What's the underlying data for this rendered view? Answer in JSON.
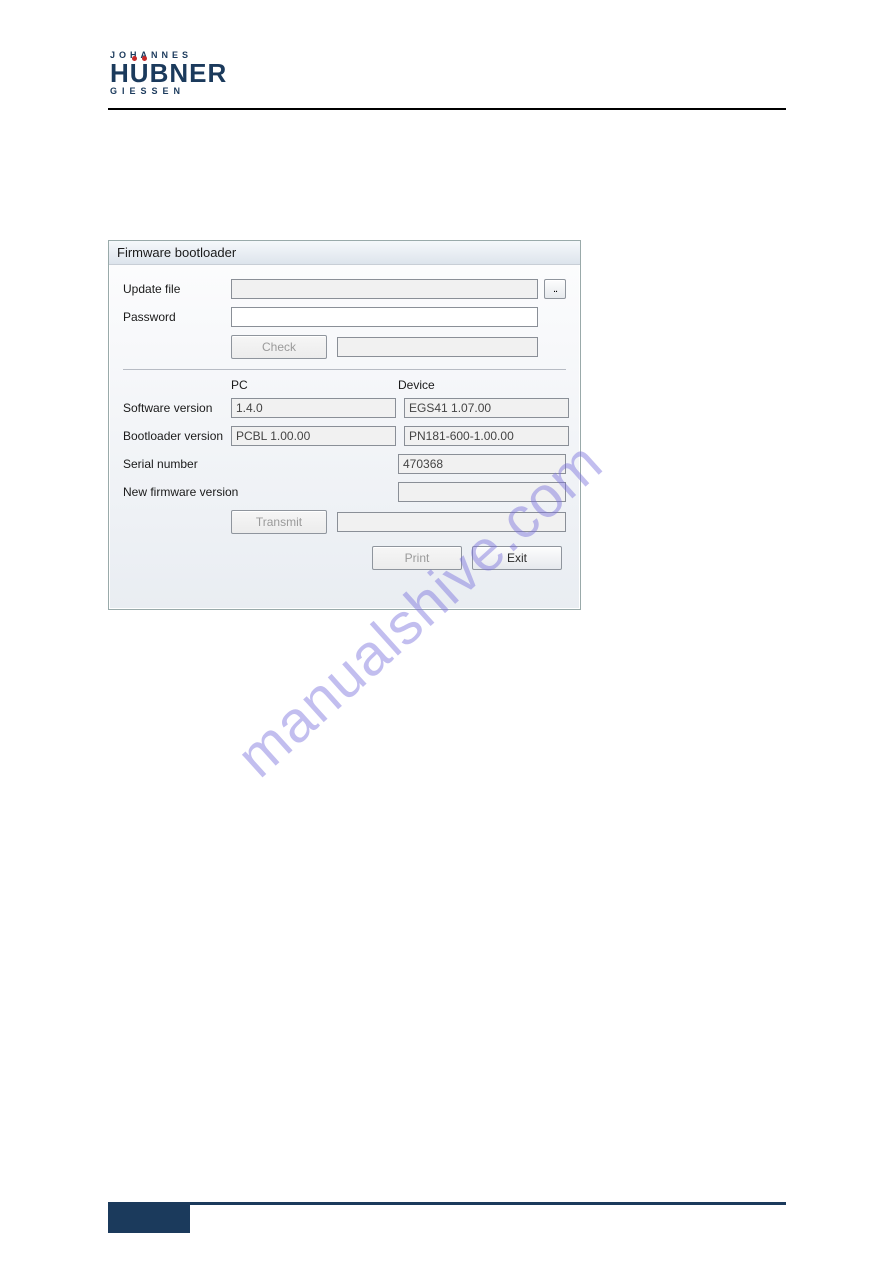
{
  "logo": {
    "top": "JOHANNES",
    "main_a": "H",
    "main_u": "U",
    "main_rest": "BNER",
    "bottom": "GIESSEN"
  },
  "watermark": "manualshive.com",
  "dialog": {
    "title": "Firmware bootloader",
    "labels": {
      "update_file": "Update file",
      "password": "Password",
      "check": "Check",
      "pc": "PC",
      "device": "Device",
      "software_version": "Software version",
      "bootloader_version": "Bootloader version",
      "serial_number": "Serial number",
      "new_fw_version": "New firmware version",
      "transmit": "Transmit",
      "print": "Print",
      "exit": "Exit",
      "browse": ".."
    },
    "values": {
      "update_file": "",
      "password": "",
      "check_status": "",
      "pc_software": "1.4.0",
      "pc_bootloader": "PCBL 1.00.00",
      "device_software": "EGS41 1.07.00",
      "device_bootloader": "PN181-600-1.00.00",
      "serial_number": "470368",
      "new_fw_version": "",
      "transmit_status": ""
    }
  }
}
